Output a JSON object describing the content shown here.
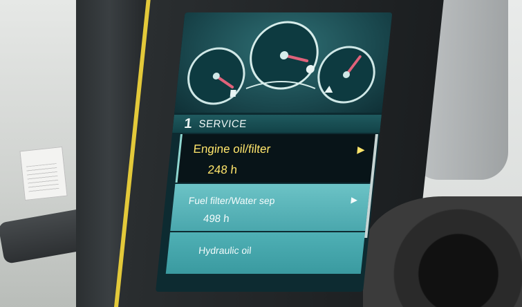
{
  "sticker": {
    "text": ""
  },
  "display": {
    "menu_header": {
      "number": "1",
      "title": "SERVICE"
    },
    "items": [
      {
        "label": "Engine oil/filter",
        "value": "248 h",
        "selected": true
      },
      {
        "label": "Fuel filter/Water sep",
        "value": "498 h",
        "selected": false
      },
      {
        "label": "Hydraulic oil",
        "value": "",
        "selected": false
      }
    ],
    "gauges": [
      {
        "name": "left-gauge",
        "icon": "fuel-icon"
      },
      {
        "name": "center-gauge",
        "icon": "engine-icon"
      },
      {
        "name": "right-gauge",
        "icon": "temperature-icon"
      }
    ],
    "colors": {
      "selected_text": "#ffe56b",
      "row_teal": "#4aa7ad",
      "header_bg": "#1f5a5f"
    }
  }
}
